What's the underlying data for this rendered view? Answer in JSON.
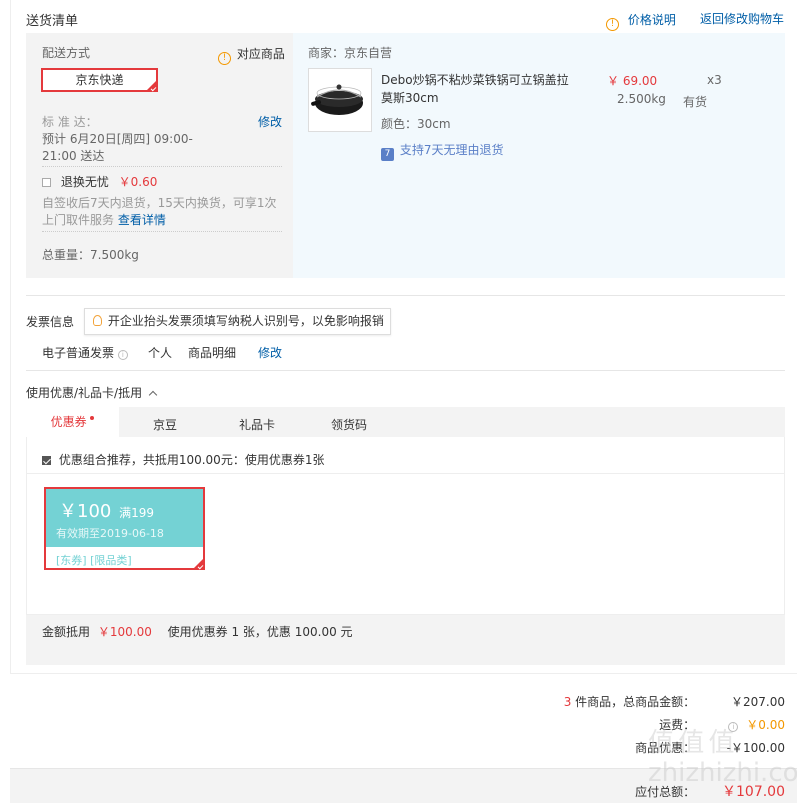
{
  "delivery": {
    "title": "送货清单",
    "price_explain": "价格说明",
    "back_to_cart": "返回修改购物车",
    "method_label": "配送方式",
    "corresponding_goods": "对应商品",
    "shipping_option": "京东快递",
    "standard_label": "标 准 达：",
    "modify": "修改",
    "eta_line1": "预计 6月20日[周四] 09:00-",
    "eta_line2": "21:00 送达",
    "worry_free_label": "退换无忧",
    "worry_free_price": "￥0.60",
    "worry_free_desc1": "自签收后7天内退货，15天内换货，可享1次",
    "worry_free_desc2": "上门取件服务",
    "view_details": "查看详情",
    "total_weight": "总重量：7.500kg"
  },
  "seller": {
    "label": "商家：京东自营",
    "product": {
      "name_line1": "Debo炒锅不粘炒菜铁锅可立锅盖拉",
      "name_line2": "莫斯30cm",
      "color": "颜色：30cm",
      "return_policy": "支持7天无理由退货",
      "price": "￥ 69.00",
      "weight": "2.500kg",
      "quantity": "x3",
      "stock": "有货"
    }
  },
  "invoice": {
    "label": "发票信息",
    "tip": "开企业抬头发票须填写纳税人识别号，以免影响报销",
    "type": "电子普通发票",
    "person": "个人",
    "detail": "商品明细",
    "modify": "修改"
  },
  "discounts": {
    "label": "使用优惠/礼品卡/抵用",
    "tabs": [
      {
        "label": "优惠券"
      },
      {
        "label": "京豆"
      },
      {
        "label": "礼品卡"
      },
      {
        "label": "领货码"
      }
    ],
    "recommend_text": "优惠组合推荐，共抵用100.00元：使用优惠券1张",
    "coupon": {
      "amount": "￥100",
      "condition": "满199",
      "validity": "有效期至2019-06-18",
      "tags": "[东券] [限品类]"
    },
    "summary_label": "金额抵用",
    "summary_amount": "￥100.00",
    "summary_text": "使用优惠券 1 张，优惠 100.00 元"
  },
  "totals": {
    "count": "3",
    "count_suffix": "件商品，总商品金额：",
    "goods_amount": "￥207.00",
    "shipping_label": "运费：",
    "shipping_amount": "￥0.00",
    "discount_label": "商品优惠：",
    "discount_amount": "-￥100.00",
    "payable_label": "应付总额：",
    "payable_amount": "￥107.00"
  },
  "watermark": "值 值 值 zhizhizhi.com",
  "colors": {
    "accent_red": "#e4393c",
    "link_blue": "#005ea7",
    "panel_gray": "#f3f3f3",
    "panel_blue": "#f2f9fd",
    "coupon_teal": "#74d2d4"
  }
}
